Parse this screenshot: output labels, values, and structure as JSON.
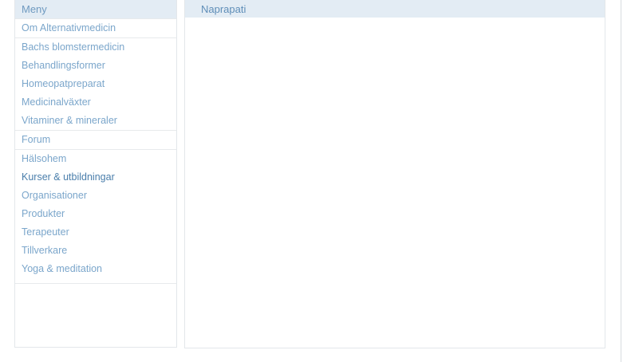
{
  "sidebar": {
    "title": "Meny",
    "groups": [
      {
        "items": [
          {
            "label": "Om Alternativmedicin"
          }
        ]
      },
      {
        "items": [
          {
            "label": "Bachs blomstermedicin"
          },
          {
            "label": "Behandlingsformer"
          },
          {
            "label": "Homeopatpreparat"
          },
          {
            "label": "Medicinalväxter"
          },
          {
            "label": "Vitaminer & mineraler"
          }
        ]
      },
      {
        "items": [
          {
            "label": "Forum"
          }
        ]
      },
      {
        "items": [
          {
            "label": "Hälsohem"
          },
          {
            "label": "Kurser & utbildningar",
            "active": true
          },
          {
            "label": "Organisationer"
          },
          {
            "label": "Produkter"
          },
          {
            "label": "Terapeuter"
          },
          {
            "label": "Tillverkare"
          },
          {
            "label": "Yoga & meditation"
          }
        ]
      }
    ]
  },
  "main": {
    "title": "Naprapati"
  },
  "colors": {
    "header_bg": "#e3ecf4",
    "link": "#7ba6cb",
    "link_active": "#4a7eab",
    "border": "#e3e7ea"
  }
}
